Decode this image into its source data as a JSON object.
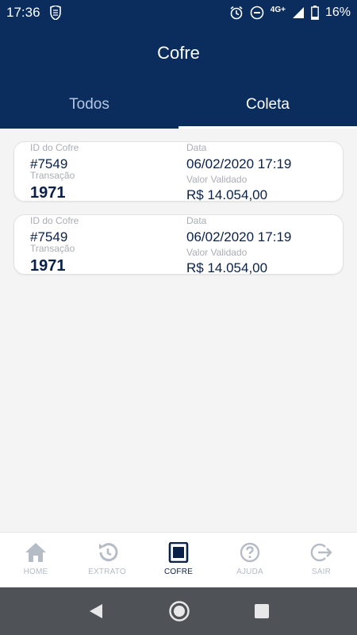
{
  "status_bar": {
    "time": "17:36",
    "network": "4G+",
    "battery": "16%"
  },
  "app_bar": {
    "title": "Cofre"
  },
  "tabs": [
    {
      "label": "Todos",
      "active": false
    },
    {
      "label": "Coleta",
      "active": true
    }
  ],
  "cards": [
    {
      "id_label": "ID do Cofre",
      "id_value": "#7549",
      "transaction_label": "Transação",
      "transaction_value": "1971",
      "date_label": "Data",
      "date_value": "06/02/2020 17:19",
      "amount_label": "Valor Validado",
      "amount_value": "R$ 14.054,00"
    },
    {
      "id_label": "ID do Cofre",
      "id_value": "#7549",
      "transaction_label": "Transação",
      "transaction_value": "1971",
      "date_label": "Data",
      "date_value": "06/02/2020 17:19",
      "amount_label": "Valor Validado",
      "amount_value": "R$ 14.054,00"
    }
  ],
  "bottom_nav": [
    {
      "label": "HOME",
      "icon": "home-icon",
      "active": false
    },
    {
      "label": "EXTRATO",
      "icon": "history-icon",
      "active": false
    },
    {
      "label": "COFRE",
      "icon": "safe-icon",
      "active": true
    },
    {
      "label": "AJUDA",
      "icon": "help-icon",
      "active": false
    },
    {
      "label": "SAIR",
      "icon": "logout-icon",
      "active": false
    }
  ],
  "colors": {
    "primary": "#0a2d5e",
    "text_dark": "#0a2148",
    "inactive": "#b5bcc6"
  }
}
